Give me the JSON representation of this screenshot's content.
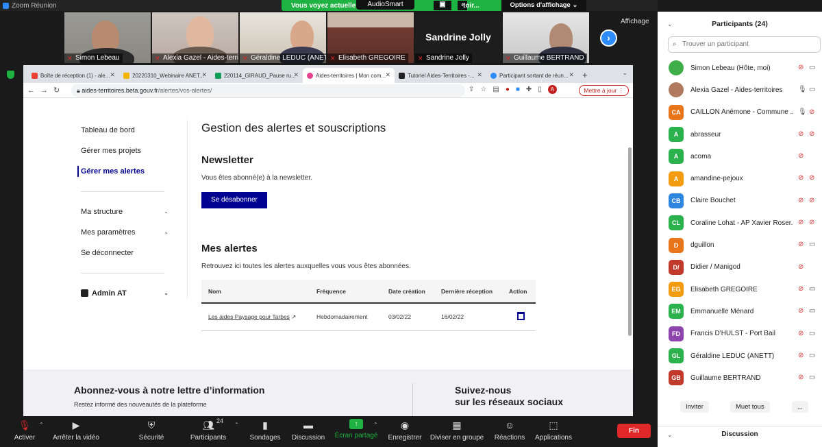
{
  "window": {
    "title": "Zoom Réunion"
  },
  "share_banner": {
    "text": "Vous voyez actuellem",
    "audiosmart": "AudioSmart",
    "text2": "toir...",
    "options": "Options d'affichage"
  },
  "gallery": {
    "tiles": [
      {
        "name": "Simon Lebeau"
      },
      {
        "name": "Alexia Gazel - Aides-territ..."
      },
      {
        "name": "Géraldine LEDUC (ANET..."
      },
      {
        "name": "Elisabeth GREGOIRE"
      },
      {
        "name": "Sandrine Jolly",
        "big_name": "Sandrine Jolly"
      },
      {
        "name": "Guillaume BERTRAND"
      }
    ],
    "affichage": "Affichage"
  },
  "browser": {
    "tabs": [
      {
        "title": "Boîte de réception (1) - ale...",
        "color": "#ea4335"
      },
      {
        "title": "20220310_Webinaire ANET...",
        "color": "#f4b400"
      },
      {
        "title": "220114_GIRAUD_Pause ru...",
        "color": "#0f9d58"
      },
      {
        "title": "Aides-territoires | Mon com...",
        "color": "#e84393"
      },
      {
        "title": "Tutoriel Aides-Territoires -...",
        "color": "#222222"
      },
      {
        "title": "Participant sortant de réun...",
        "color": "#2d8cff"
      }
    ],
    "url_host": "aides-territoires.beta.gouv.fr",
    "url_path": "/alertes/vos-alertes/",
    "update_label": "Mettre à jour",
    "avatar_letter": "A"
  },
  "page": {
    "sidenav": {
      "dashboard": "Tableau de bord",
      "projects": "Gérer mes projets",
      "alerts": "Gérer mes alertes",
      "structure": "Ma structure",
      "settings": "Mes paramètres",
      "logout": "Se déconnecter",
      "admin": "Admin AT"
    },
    "title": "Gestion des alertes et souscriptions",
    "newsletter": {
      "heading": "Newsletter",
      "text": "Vous êtes abonné(e) à la newsletter.",
      "button": "Se désabonner"
    },
    "alerts": {
      "heading": "Mes alertes",
      "text": "Retrouvez ici toutes les alertes auxquelles vous vous êtes abonnées.",
      "columns": [
        "Nom",
        "Fréquence",
        "Date création",
        "Dernière réception",
        "Action"
      ],
      "rows": [
        {
          "name": "Les aides Paysage pour Tarbes",
          "frequency": "Hebdomadairement",
          "created": "03/02/22",
          "last": "16/02/22"
        }
      ]
    },
    "footer": {
      "title": "Abonnez-vous à notre lettre d’information",
      "subtitle": "Restez informé des nouveautés de la plateforme",
      "social_line1": "Suivez-nous",
      "social_line2": "sur les réseaux sociaux"
    }
  },
  "panel": {
    "title": "Participants (24)",
    "search_placeholder": "Trouver un participant",
    "participants": [
      {
        "initials": "",
        "color": "#3fae49",
        "name": "Simon Lebeau (Hôte, moi)",
        "mic": "muted",
        "cam": "on"
      },
      {
        "initials": "",
        "color": "#b07a60",
        "name": "Alexia Gazel - Aides-territoires",
        "mic": "on",
        "cam": "on"
      },
      {
        "initials": "CA",
        "color": "#e8751a",
        "name": "CAILLON Anémone - Commune ...",
        "mic": "on",
        "cam": "off"
      },
      {
        "initials": "A",
        "color": "#2bb24c",
        "name": "abrasseur",
        "mic": "muted",
        "cam": "off"
      },
      {
        "initials": "A",
        "color": "#2bb24c",
        "name": "acoma",
        "mic": "muted",
        "cam": "none"
      },
      {
        "initials": "A",
        "color": "#f39c12",
        "name": "amandine-pejoux",
        "mic": "muted",
        "cam": "off"
      },
      {
        "initials": "CB",
        "color": "#2e86de",
        "name": "Claire Bouchet",
        "mic": "muted",
        "cam": "off"
      },
      {
        "initials": "CL",
        "color": "#2bb24c",
        "name": "Coraline Lohat - AP Xavier Roser...",
        "mic": "muted",
        "cam": "off"
      },
      {
        "initials": "D",
        "color": "#e8751a",
        "name": "dguillon",
        "mic": "muted",
        "cam": "on"
      },
      {
        "initials": "D/",
        "color": "#c0392b",
        "name": "Didier / Manigod",
        "mic": "muted",
        "cam": "none"
      },
      {
        "initials": "EG",
        "color": "#f39c12",
        "name": "Elisabeth GREGOIRE",
        "mic": "muted",
        "cam": "on"
      },
      {
        "initials": "EM",
        "color": "#2bb24c",
        "name": "Emmanuelle Ménard",
        "mic": "muted",
        "cam": "on"
      },
      {
        "initials": "FD",
        "color": "#8e44ad",
        "name": "Francis D'HULST - Port Bail",
        "mic": "muted",
        "cam": "on"
      },
      {
        "initials": "GL",
        "color": "#2bb24c",
        "name": "Géraldine LEDUC (ANETT)",
        "mic": "muted",
        "cam": "on"
      },
      {
        "initials": "GB",
        "color": "#c0392b",
        "name": "Guillaume BERTRAND",
        "mic": "muted",
        "cam": "on"
      }
    ],
    "invite": "Inviter",
    "mute_all": "Muet tous",
    "more": "...",
    "discussion": "Discussion"
  },
  "toolbar": {
    "activate": "Activer",
    "stop_video": "Arrêter la vidéo",
    "security": "Sécurité",
    "participants": "Participants",
    "participants_count": "24",
    "polls": "Sondages",
    "chat": "Discussion",
    "share": "Écran partagé",
    "record": "Enregistrer",
    "breakout": "Diviser en groupe",
    "reactions": "Réactions",
    "apps": "Applications",
    "end": "Fin"
  }
}
